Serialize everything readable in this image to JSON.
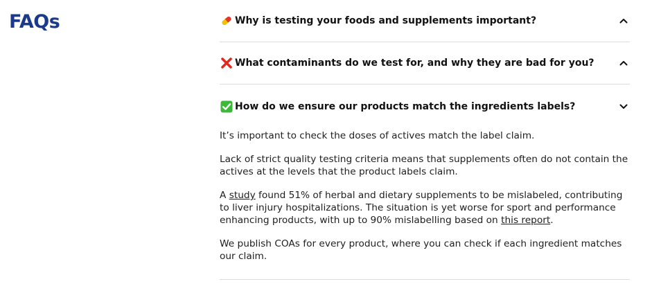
{
  "page": {
    "heading": "FAQs"
  },
  "colors": {
    "heading": "#1b3a8c",
    "divider": "#dcdcdc"
  },
  "faqs": [
    {
      "icon": "pill-icon",
      "question": "Why is testing your foods and supplements important?",
      "state": "collapsed"
    },
    {
      "icon": "red-x-icon",
      "question": "What contaminants do we test for, and why they are bad for you?",
      "state": "collapsed"
    },
    {
      "icon": "green-check-icon",
      "question": "How do we ensure our products match the ingredients labels?",
      "state": "expanded",
      "answer": {
        "p1": "It’s important to check the doses of actives match the label claim.",
        "p2": "Lack of strict quality testing criteria means that supplements often do not contain the actives at the levels that the product labels claim.",
        "p3_prefix": "A ",
        "p3_link1": "study",
        "p3_middle": " found 51% of herbal and dietary supplements to be mislabeled, contributing to liver injury hospitalizations. The situation is yet worse for sport and performance enhancing products, with up to 90% mislabelling based on ",
        "p3_link2": "this report",
        "p3_suffix": ".",
        "p4": "We publish COAs for every product, where you can check if each ingredient matches our claim."
      }
    }
  ]
}
